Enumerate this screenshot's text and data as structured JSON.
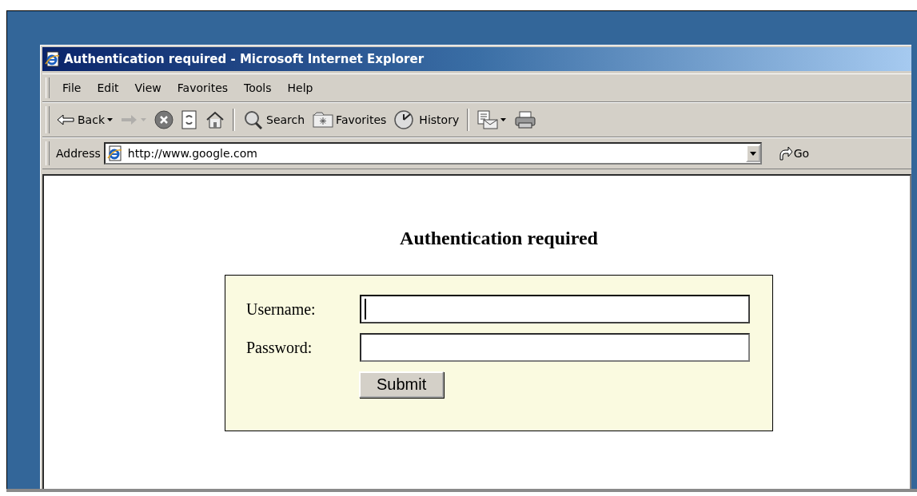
{
  "window": {
    "title": "Authentication required - Microsoft Internet Explorer"
  },
  "menu": [
    {
      "label": "File"
    },
    {
      "label": "Edit"
    },
    {
      "label": "View"
    },
    {
      "label": "Favorites"
    },
    {
      "label": "Tools"
    },
    {
      "label": "Help"
    }
  ],
  "toolbar": [
    {
      "kind": "button",
      "label": "Back",
      "dropdown": true
    },
    {
      "kind": "button",
      "dropdown": true,
      "disabled": true
    },
    {
      "kind": "button"
    },
    {
      "kind": "button"
    },
    {
      "kind": "button"
    },
    {
      "kind": "separator"
    },
    {
      "kind": "button",
      "label": "Search"
    },
    {
      "kind": "button",
      "label": "Favorites"
    },
    {
      "kind": "button",
      "label": "History"
    },
    {
      "kind": "separator"
    },
    {
      "kind": "button",
      "dropdown": true
    },
    {
      "kind": "button"
    }
  ],
  "address_bar": {
    "label": "Address",
    "url": "http://www.google.com",
    "go": "Go"
  },
  "page": {
    "heading": "Authentication required",
    "fields": [
      {
        "label": "Username:",
        "focused": true
      },
      {
        "label": "Password:",
        "focused": false
      }
    ],
    "submit": "Submit"
  }
}
